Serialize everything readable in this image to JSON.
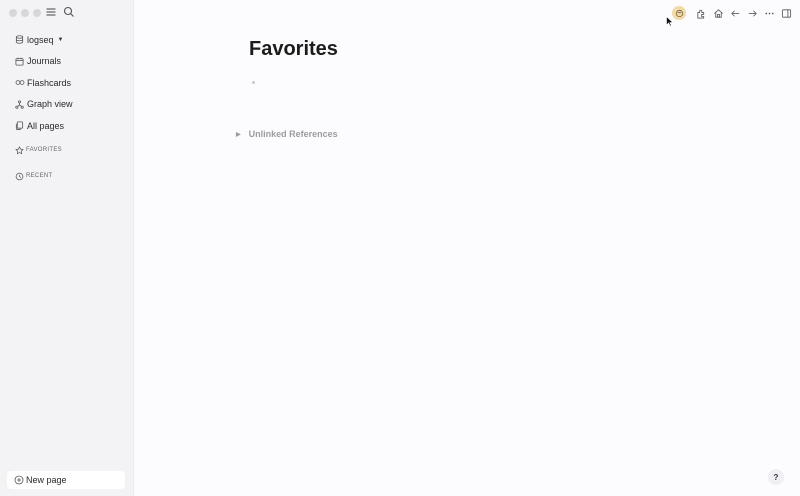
{
  "sidebar": {
    "graph": {
      "label": "logseq"
    },
    "items": [
      {
        "label": "Journals",
        "icon": "calendar-icon"
      },
      {
        "label": "Flashcards",
        "icon": "infinity-icon"
      },
      {
        "label": "Graph view",
        "icon": "graph-icon"
      },
      {
        "label": "All pages",
        "icon": "pages-icon"
      }
    ],
    "favorites_label": "FAVORITES",
    "recent_label": "RECENT",
    "new_page_label": "New page"
  },
  "main": {
    "title": "Favorites",
    "unlinked_label": "Unlinked References"
  },
  "help_label": "?",
  "colors": {
    "sidebar_bg": "#f3f2f5",
    "main_bg": "#fcfbfd",
    "avatar_bg": "#f3d8a8"
  }
}
